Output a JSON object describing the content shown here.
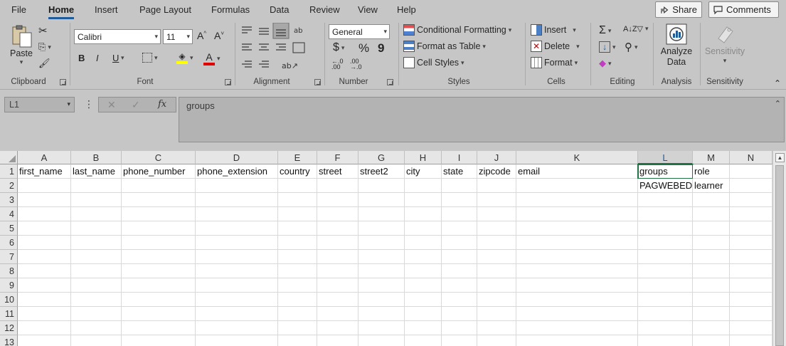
{
  "menu": {
    "tabs": [
      "File",
      "Home",
      "Insert",
      "Page Layout",
      "Formulas",
      "Data",
      "Review",
      "View",
      "Help"
    ],
    "active": "Home",
    "share_label": "Share",
    "comments_label": "Comments"
  },
  "ribbon": {
    "clipboard": {
      "label": "Clipboard",
      "paste_label": "Paste"
    },
    "font": {
      "label": "Font",
      "font_name": "Calibri",
      "font_size": "11",
      "bold": "B",
      "italic": "I",
      "underline": "U",
      "grow": "A^",
      "shrink": "A˅"
    },
    "alignment": {
      "label": "Alignment"
    },
    "number": {
      "label": "Number",
      "format": "General",
      "currency": "$",
      "percent": "%",
      "comma": "9"
    },
    "styles": {
      "label": "Styles",
      "conditional": "Conditional Formatting",
      "format_table": "Format as Table",
      "cell_styles": "Cell Styles"
    },
    "cells": {
      "label": "Cells",
      "insert": "Insert",
      "delete": "Delete",
      "format": "Format"
    },
    "editing": {
      "label": "Editing"
    },
    "analysis": {
      "label": "Analysis",
      "analyze_line1": "Analyze",
      "analyze_line2": "Data"
    },
    "sensitivity": {
      "label": "Sensitivity",
      "button": "Sensitivity"
    }
  },
  "formula_bar": {
    "name_box": "L1",
    "fx": "fx",
    "content": "groups"
  },
  "sheet": {
    "columns": [
      "A",
      "B",
      "C",
      "D",
      "E",
      "F",
      "G",
      "H",
      "I",
      "J",
      "K",
      "L",
      "M",
      "N"
    ],
    "selected_column": "L",
    "rows": [
      "1",
      "2",
      "3",
      "4",
      "5",
      "6",
      "7",
      "8",
      "9",
      "10",
      "11",
      "12",
      "13"
    ],
    "row1": [
      "first_name",
      "last_name",
      "phone_number",
      "phone_extension",
      "country",
      "street",
      "street2",
      "city",
      "state",
      "zipcode",
      "email",
      "groups",
      "role",
      ""
    ],
    "row2": [
      "",
      "",
      "",
      "",
      "",
      "",
      "",
      "",
      "",
      "",
      "",
      "PAGWEBED",
      "learner",
      ""
    ]
  }
}
